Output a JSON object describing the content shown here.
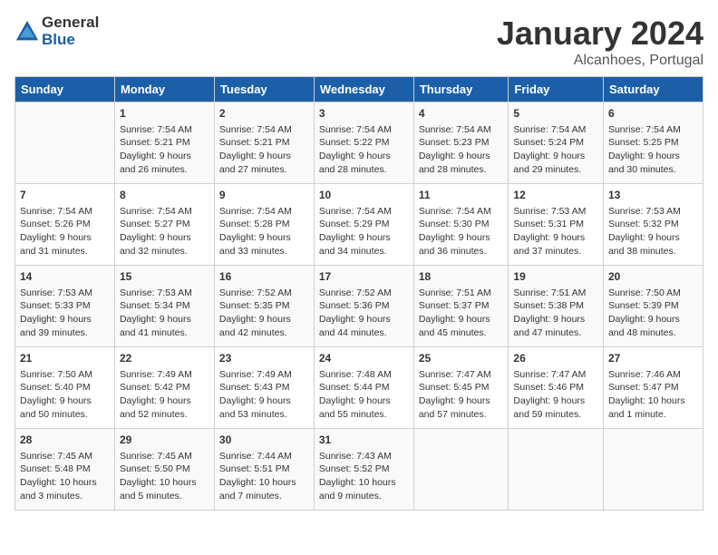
{
  "header": {
    "logo_general": "General",
    "logo_blue": "Blue",
    "month": "January 2024",
    "location": "Alcanhoes, Portugal"
  },
  "columns": [
    "Sunday",
    "Monday",
    "Tuesday",
    "Wednesday",
    "Thursday",
    "Friday",
    "Saturday"
  ],
  "weeks": [
    [
      {
        "day": "",
        "info": ""
      },
      {
        "day": "1",
        "info": "Sunrise: 7:54 AM\nSunset: 5:21 PM\nDaylight: 9 hours\nand 26 minutes."
      },
      {
        "day": "2",
        "info": "Sunrise: 7:54 AM\nSunset: 5:21 PM\nDaylight: 9 hours\nand 27 minutes."
      },
      {
        "day": "3",
        "info": "Sunrise: 7:54 AM\nSunset: 5:22 PM\nDaylight: 9 hours\nand 28 minutes."
      },
      {
        "day": "4",
        "info": "Sunrise: 7:54 AM\nSunset: 5:23 PM\nDaylight: 9 hours\nand 28 minutes."
      },
      {
        "day": "5",
        "info": "Sunrise: 7:54 AM\nSunset: 5:24 PM\nDaylight: 9 hours\nand 29 minutes."
      },
      {
        "day": "6",
        "info": "Sunrise: 7:54 AM\nSunset: 5:25 PM\nDaylight: 9 hours\nand 30 minutes."
      }
    ],
    [
      {
        "day": "7",
        "info": "Sunrise: 7:54 AM\nSunset: 5:26 PM\nDaylight: 9 hours\nand 31 minutes."
      },
      {
        "day": "8",
        "info": "Sunrise: 7:54 AM\nSunset: 5:27 PM\nDaylight: 9 hours\nand 32 minutes."
      },
      {
        "day": "9",
        "info": "Sunrise: 7:54 AM\nSunset: 5:28 PM\nDaylight: 9 hours\nand 33 minutes."
      },
      {
        "day": "10",
        "info": "Sunrise: 7:54 AM\nSunset: 5:29 PM\nDaylight: 9 hours\nand 34 minutes."
      },
      {
        "day": "11",
        "info": "Sunrise: 7:54 AM\nSunset: 5:30 PM\nDaylight: 9 hours\nand 36 minutes."
      },
      {
        "day": "12",
        "info": "Sunrise: 7:53 AM\nSunset: 5:31 PM\nDaylight: 9 hours\nand 37 minutes."
      },
      {
        "day": "13",
        "info": "Sunrise: 7:53 AM\nSunset: 5:32 PM\nDaylight: 9 hours\nand 38 minutes."
      }
    ],
    [
      {
        "day": "14",
        "info": "Sunrise: 7:53 AM\nSunset: 5:33 PM\nDaylight: 9 hours\nand 39 minutes."
      },
      {
        "day": "15",
        "info": "Sunrise: 7:53 AM\nSunset: 5:34 PM\nDaylight: 9 hours\nand 41 minutes."
      },
      {
        "day": "16",
        "info": "Sunrise: 7:52 AM\nSunset: 5:35 PM\nDaylight: 9 hours\nand 42 minutes."
      },
      {
        "day": "17",
        "info": "Sunrise: 7:52 AM\nSunset: 5:36 PM\nDaylight: 9 hours\nand 44 minutes."
      },
      {
        "day": "18",
        "info": "Sunrise: 7:51 AM\nSunset: 5:37 PM\nDaylight: 9 hours\nand 45 minutes."
      },
      {
        "day": "19",
        "info": "Sunrise: 7:51 AM\nSunset: 5:38 PM\nDaylight: 9 hours\nand 47 minutes."
      },
      {
        "day": "20",
        "info": "Sunrise: 7:50 AM\nSunset: 5:39 PM\nDaylight: 9 hours\nand 48 minutes."
      }
    ],
    [
      {
        "day": "21",
        "info": "Sunrise: 7:50 AM\nSunset: 5:40 PM\nDaylight: 9 hours\nand 50 minutes."
      },
      {
        "day": "22",
        "info": "Sunrise: 7:49 AM\nSunset: 5:42 PM\nDaylight: 9 hours\nand 52 minutes."
      },
      {
        "day": "23",
        "info": "Sunrise: 7:49 AM\nSunset: 5:43 PM\nDaylight: 9 hours\nand 53 minutes."
      },
      {
        "day": "24",
        "info": "Sunrise: 7:48 AM\nSunset: 5:44 PM\nDaylight: 9 hours\nand 55 minutes."
      },
      {
        "day": "25",
        "info": "Sunrise: 7:47 AM\nSunset: 5:45 PM\nDaylight: 9 hours\nand 57 minutes."
      },
      {
        "day": "26",
        "info": "Sunrise: 7:47 AM\nSunset: 5:46 PM\nDaylight: 9 hours\nand 59 minutes."
      },
      {
        "day": "27",
        "info": "Sunrise: 7:46 AM\nSunset: 5:47 PM\nDaylight: 10 hours\nand 1 minute."
      }
    ],
    [
      {
        "day": "28",
        "info": "Sunrise: 7:45 AM\nSunset: 5:48 PM\nDaylight: 10 hours\nand 3 minutes."
      },
      {
        "day": "29",
        "info": "Sunrise: 7:45 AM\nSunset: 5:50 PM\nDaylight: 10 hours\nand 5 minutes."
      },
      {
        "day": "30",
        "info": "Sunrise: 7:44 AM\nSunset: 5:51 PM\nDaylight: 10 hours\nand 7 minutes."
      },
      {
        "day": "31",
        "info": "Sunrise: 7:43 AM\nSunset: 5:52 PM\nDaylight: 10 hours\nand 9 minutes."
      },
      {
        "day": "",
        "info": ""
      },
      {
        "day": "",
        "info": ""
      },
      {
        "day": "",
        "info": ""
      }
    ]
  ]
}
